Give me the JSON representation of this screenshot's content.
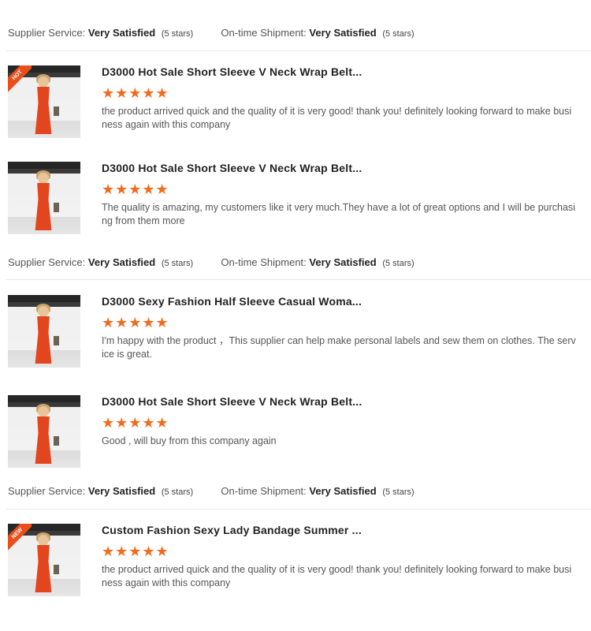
{
  "summaries": [
    {
      "supplier_label": "Supplier Service:",
      "supplier_value": "Very Satisfied",
      "supplier_count": "(5 stars)",
      "shipment_label": "On-time Shipment:",
      "shipment_value": "Very Satisfied",
      "shipment_count": "(5 stars)"
    },
    {
      "supplier_label": "Supplier Service:",
      "supplier_value": "Very Satisfied",
      "supplier_count": "(5 stars)",
      "shipment_label": "On-time Shipment:",
      "shipment_value": "Very Satisfied",
      "shipment_count": "(5 stars)"
    },
    {
      "supplier_label": "Supplier Service:",
      "supplier_value": "Very Satisfied",
      "supplier_count": "(5 stars)",
      "shipment_label": "On-time Shipment:",
      "shipment_value": "Very Satisfied",
      "shipment_count": "(5 stars)"
    }
  ],
  "reviews": [
    {
      "title": "D3000 Hot Sale Short Sleeve V Neck Wrap Belt...",
      "rating": 5,
      "stars": "★★★★★",
      "hot_badge": "HOT",
      "comment": "the product arrived quick and the quality of it is very good! thank you! definitely looking forward to make business again with this company"
    },
    {
      "title": "D3000 Hot Sale Short Sleeve V Neck Wrap Belt...",
      "rating": 5,
      "stars": "★★★★★",
      "comment": "The quality is amazing, my customers like it very much.They have a lot of great options and I will be purchasing from them more"
    },
    {
      "title": "D3000 Sexy Fashion Half Sleeve Casual Woma...",
      "rating": 5,
      "stars": "★★★★★",
      "comment": "I'm happy with the product ，This supplier can help make personal labels and sew them on clothes. The service is great."
    },
    {
      "title": "D3000 Hot Sale Short Sleeve V Neck Wrap Belt...",
      "rating": 5,
      "stars": "★★★★★",
      "comment": "Good , will buy from this company again"
    },
    {
      "title": "Custom Fashion Sexy Lady Bandage Summer ...",
      "rating": 5,
      "stars": "★★★★★",
      "hot_badge": "NEW",
      "comment": "the product arrived quick and the quality of it is very good! thank you! definitely looking forward to make business again with this company"
    }
  ],
  "colors": {
    "star": "#f26b1d",
    "badge": "#e94e1b"
  }
}
